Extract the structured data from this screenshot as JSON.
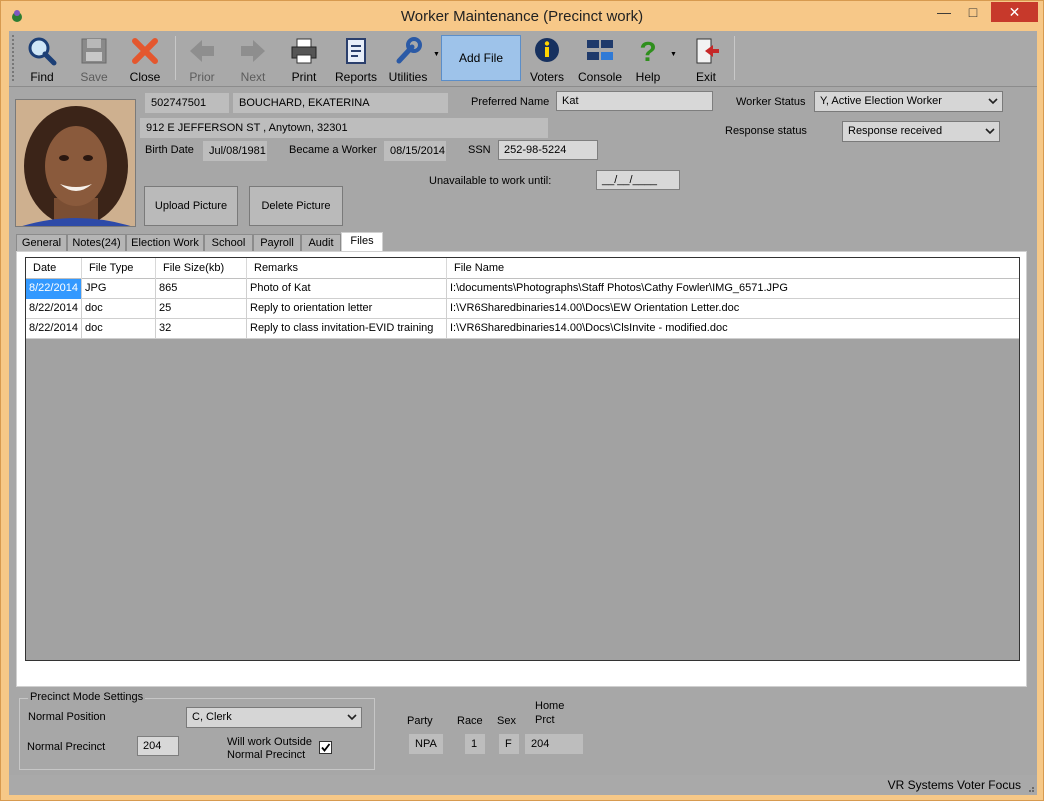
{
  "window": {
    "title": "Worker Maintenance (Precinct work)"
  },
  "toolbar": {
    "find": "Find",
    "save": "Save",
    "close": "Close",
    "prior": "Prior",
    "next": "Next",
    "print": "Print",
    "reports": "Reports",
    "utilities": "Utilities",
    "add_file": "Add File",
    "voters": "Voters",
    "console": "Console",
    "help": "Help",
    "exit": "Exit"
  },
  "worker": {
    "id": "502747501",
    "name": "BOUCHARD, EKATERINA",
    "address": "912 E JEFFERSON ST , Anytown, 32301",
    "birth_date_label": "Birth Date",
    "birth_date": "Jul/08/1981",
    "became_worker_label": "Became a Worker",
    "became_worker": "08/15/2014",
    "ssn_label": "SSN",
    "ssn": "252-98-5224",
    "preferred_name_label": "Preferred Name",
    "preferred_name": "Kat",
    "worker_status_label": "Worker Status",
    "worker_status": "Y, Active Election Worker",
    "response_status_label": "Response status",
    "response_status": "Response received",
    "unavailable_label": "Unavailable to work until:",
    "unavailable_until": "__/__/____",
    "upload_picture": "Upload Picture",
    "delete_picture": "Delete Picture"
  },
  "tabs": [
    "General",
    "Notes(24)",
    "Election Work",
    "School",
    "Payroll",
    "Audit",
    "Files"
  ],
  "active_tab": "Files",
  "files_table": {
    "columns": [
      "Date",
      "File Type",
      "File Size(kb)",
      "Remarks",
      "File Name"
    ],
    "rows": [
      [
        "8/22/2014",
        "JPG",
        "865",
        "Photo of Kat",
        "I:\\documents\\Photographs\\Staff Photos\\Cathy Fowler\\IMG_6571.JPG"
      ],
      [
        "8/22/2014",
        "doc",
        "25",
        "Reply to orientation letter",
        "I:\\VR6Sharedbinaries14.00\\Docs\\EW Orientation Letter.doc"
      ],
      [
        "8/22/2014",
        "doc",
        "32",
        "Reply to class invitation-EVID training",
        "I:\\VR6Sharedbinaries14.00\\Docs\\ClsInvite - modified.doc"
      ]
    ]
  },
  "precinct": {
    "group_title": "Precinct Mode Settings",
    "normal_position_label": "Normal Position",
    "normal_position": "C, Clerk",
    "normal_precinct_label": "Normal Precinct",
    "normal_precinct": "204",
    "outside_label_1": "Will work Outside",
    "outside_label_2": "Normal Precinct",
    "outside_checked": true
  },
  "demographics": {
    "party_label": "Party",
    "party": "NPA",
    "race_label": "Race",
    "race": "1",
    "sex_label": "Sex",
    "sex": "F",
    "home_label_1": "Home",
    "home_label_2": "Prct",
    "home_prct": "204"
  },
  "status_bar": {
    "text": "VR Systems Voter Focus"
  }
}
